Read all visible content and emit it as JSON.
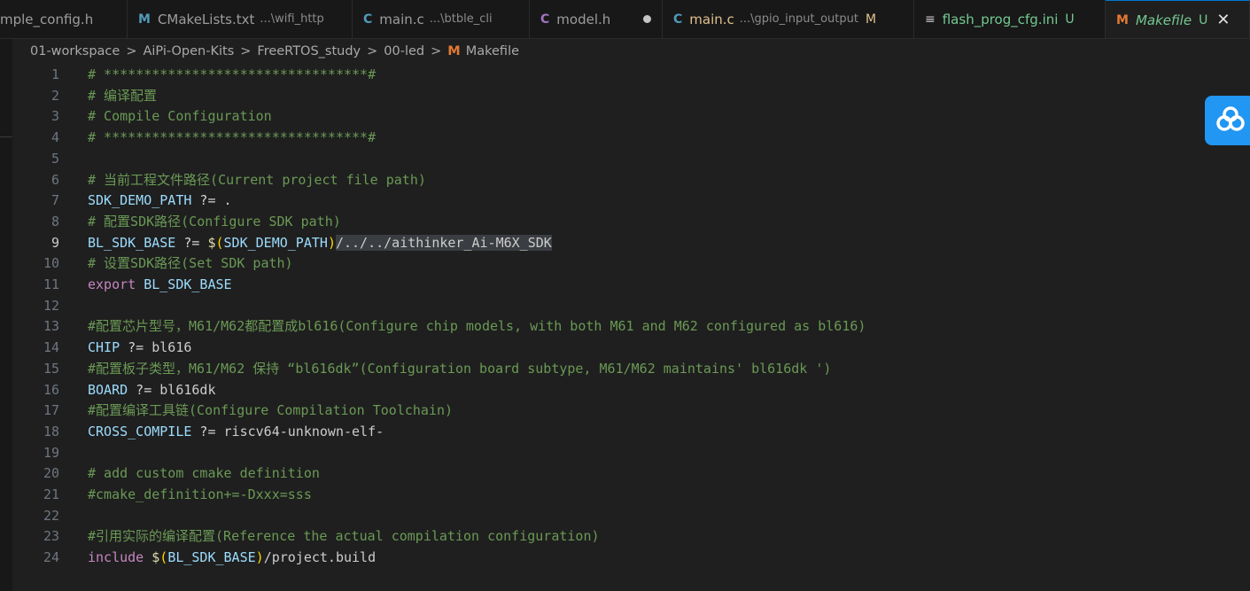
{
  "tabs": [
    {
      "label": "mple_config.h",
      "desc": "",
      "icon": "",
      "badge": ""
    },
    {
      "label": "CMakeLists.txt",
      "desc": "...\\wifi_http",
      "icon": "M",
      "badge": ""
    },
    {
      "label": "main.c",
      "desc": "...\\btble_cli",
      "icon": "C",
      "badge": ""
    },
    {
      "label": "model.h",
      "desc": "",
      "icon": "C",
      "badge": ""
    },
    {
      "label": "main.c",
      "desc": "...\\gpio_input_output",
      "icon": "C",
      "badge": "M"
    },
    {
      "label": "flash_prog_cfg.ini",
      "desc": "",
      "icon": "≡",
      "badge": "U"
    },
    {
      "label": "Makefile",
      "desc": "",
      "icon": "M",
      "badge": "U"
    }
  ],
  "close_glyph": "✕",
  "breadcrumb": {
    "items": [
      "01-workspace",
      "AiPi-Open-Kits",
      "FreeRTOS_study",
      "00-led",
      "Makefile"
    ],
    "separator": ">",
    "file_icon": "M"
  },
  "colors": {
    "accent": "#0078d4",
    "comment": "#6a9955",
    "variable": "#9cdcfe",
    "keyword": "#c586c0",
    "dollar": "#dcdcaa",
    "paren": "#ffd700",
    "cloud": "#2196f3"
  },
  "editor": {
    "current_line": 9,
    "lines": [
      {
        "n": "1",
        "t": [
          {
            "c": "c",
            "s": "# *********************************#"
          }
        ]
      },
      {
        "n": "2",
        "t": [
          {
            "c": "c",
            "s": "# 编译配置"
          }
        ]
      },
      {
        "n": "3",
        "t": [
          {
            "c": "c",
            "s": "# Compile Configuration"
          }
        ]
      },
      {
        "n": "4",
        "t": [
          {
            "c": "c",
            "s": "# *********************************#"
          }
        ]
      },
      {
        "n": "5",
        "t": []
      },
      {
        "n": "6",
        "t": [
          {
            "c": "c",
            "s": "# 当前工程文件路径(Current project file path)"
          }
        ]
      },
      {
        "n": "7",
        "t": [
          {
            "c": "v",
            "s": "SDK_DEMO_PATH"
          },
          {
            "c": "o",
            "s": " ?= "
          },
          {
            "c": "s",
            "s": "."
          }
        ]
      },
      {
        "n": "8",
        "t": [
          {
            "c": "c",
            "s": "# 配置SDK路径(Configure SDK path)"
          }
        ]
      },
      {
        "n": "9",
        "t": [
          {
            "c": "v",
            "s": "BL_SDK_BASE"
          },
          {
            "c": "o",
            "s": " ?= "
          },
          {
            "c": "d",
            "s": "$"
          },
          {
            "c": "p",
            "s": "("
          },
          {
            "c": "v",
            "s": "SDK_DEMO_PATH"
          },
          {
            "c": "p",
            "s": ")"
          },
          {
            "c": "s hl",
            "s": "/../../aithinker_Ai-M6X_SDK"
          }
        ]
      },
      {
        "n": "10",
        "t": [
          {
            "c": "c",
            "s": "# 设置SDK路径(Set SDK path)"
          }
        ]
      },
      {
        "n": "11",
        "t": [
          {
            "c": "k",
            "s": "export"
          },
          {
            "c": "o",
            "s": " "
          },
          {
            "c": "v",
            "s": "BL_SDK_BASE"
          }
        ]
      },
      {
        "n": "12",
        "t": []
      },
      {
        "n": "13",
        "t": [
          {
            "c": "c",
            "s": "#配置芯片型号，M61/M62都配置成bl616(Configure chip models, with both M61 and M62 configured as bl616)"
          }
        ]
      },
      {
        "n": "14",
        "t": [
          {
            "c": "v",
            "s": "CHIP"
          },
          {
            "c": "o",
            "s": " ?= "
          },
          {
            "c": "s",
            "s": "bl616"
          }
        ]
      },
      {
        "n": "15",
        "t": [
          {
            "c": "c",
            "s": "#配置板子类型，M61/M62 保持 “bl616dk”(Configuration board subtype, M61/M62 maintains' bl616dk ')"
          }
        ]
      },
      {
        "n": "16",
        "t": [
          {
            "c": "v",
            "s": "BOARD"
          },
          {
            "c": "o",
            "s": " ?= "
          },
          {
            "c": "s",
            "s": "bl616dk"
          }
        ]
      },
      {
        "n": "17",
        "t": [
          {
            "c": "c",
            "s": "#配置编译工具链(Configure Compilation Toolchain)"
          }
        ]
      },
      {
        "n": "18",
        "t": [
          {
            "c": "v",
            "s": "CROSS_COMPILE"
          },
          {
            "c": "o",
            "s": " ?= "
          },
          {
            "c": "s",
            "s": "riscv64-unknown-elf-"
          }
        ]
      },
      {
        "n": "19",
        "t": []
      },
      {
        "n": "20",
        "t": [
          {
            "c": "c",
            "s": "# add custom cmake definition"
          }
        ]
      },
      {
        "n": "21",
        "t": [
          {
            "c": "c",
            "s": "#cmake_definition+=-Dxxx=sss"
          }
        ]
      },
      {
        "n": "22",
        "t": []
      },
      {
        "n": "23",
        "t": [
          {
            "c": "c",
            "s": "#引用实际的编译配置(Reference the actual compilation configuration)"
          }
        ]
      },
      {
        "n": "24",
        "t": [
          {
            "c": "k",
            "s": "include"
          },
          {
            "c": "o",
            "s": " "
          },
          {
            "c": "d",
            "s": "$"
          },
          {
            "c": "p",
            "s": "("
          },
          {
            "c": "v",
            "s": "BL_SDK_BASE"
          },
          {
            "c": "p",
            "s": ")"
          },
          {
            "c": "s",
            "s": "/project.build"
          }
        ]
      }
    ]
  }
}
